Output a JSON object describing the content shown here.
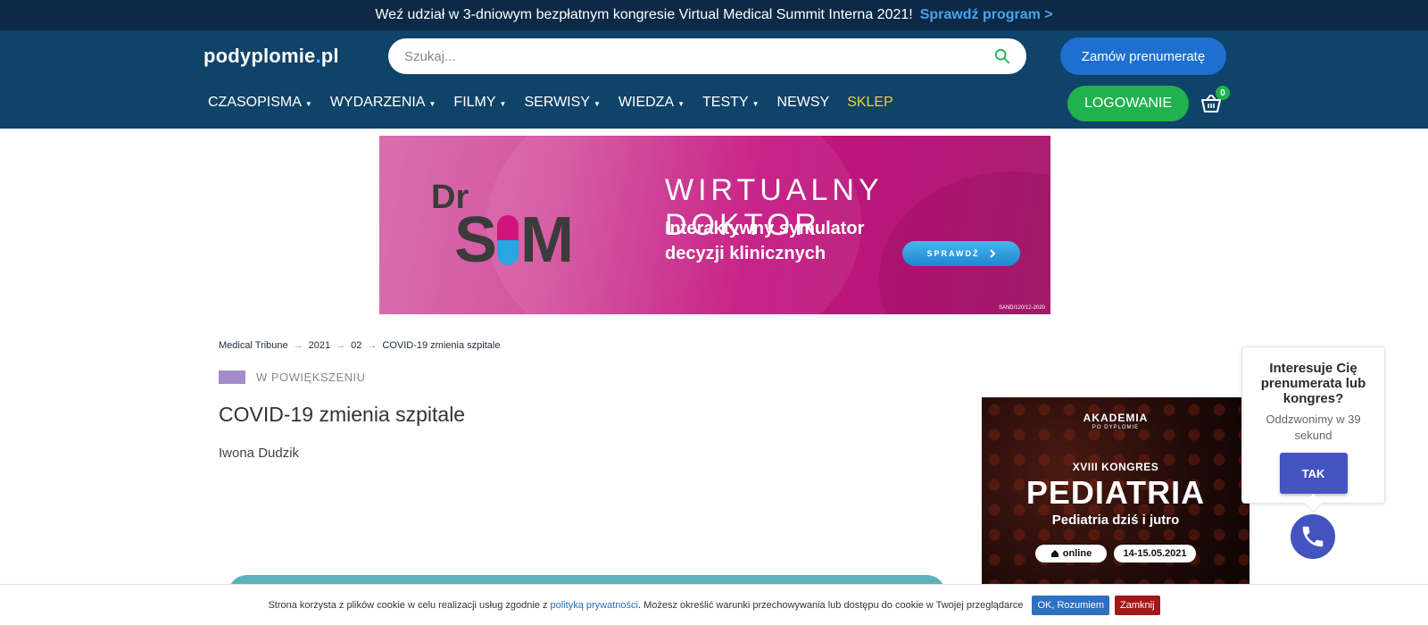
{
  "promo": {
    "text": "Weź udział w 3-dniowym bezpłatnym kongresie Virtual Medical Summit Interna 2021!",
    "link": "Sprawdź program >"
  },
  "header": {
    "logo_main": "podyplomie",
    "logo_dot": ".",
    "logo_tld": "pl",
    "search_placeholder": "Szukaj...",
    "subscribe_label": "Zamów prenumeratę",
    "login_label": "LOGOWANIE",
    "cart_count": "0",
    "nav": [
      {
        "label": "CZASOPISMA",
        "caret": "▼"
      },
      {
        "label": "WYDARZENIA",
        "caret": "▼"
      },
      {
        "label": "FILMY",
        "caret": "▼"
      },
      {
        "label": "SERWISY",
        "caret": "▼"
      },
      {
        "label": "WIEDZA",
        "caret": "▼"
      },
      {
        "label": "TESTY",
        "caret": "▼"
      },
      {
        "label": "NEWSY",
        "caret": ""
      },
      {
        "label": "SKLEP",
        "caret": ""
      }
    ]
  },
  "banner": {
    "dr": "Dr",
    "sim_s": "S",
    "sim_m": "M",
    "headline": "WIRTUALNY DOKTOR",
    "sub_line1": "Interaktywny symulator",
    "sub_line2": "decyzji klinicznych",
    "button": "SPRAWDŹ",
    "code": "SAND/120/12-2020"
  },
  "breadcrumb": [
    "Medical Tribune",
    "2021",
    "02",
    "COVID-19 zmienia szpitale"
  ],
  "breadcrumb_sep": "→",
  "article": {
    "category": "W POWIĘKSZENIU",
    "title": "COVID-19 zmienia szpitale",
    "author": "Iwona Dudzik"
  },
  "side_ad": {
    "akademia": "AKADEMIA",
    "akademia_sub": "PO DYPLOMIE",
    "kongres": "XVIII KONGRES",
    "title": "PEDIATRIA",
    "tagline": "Pediatria dziś i jutro",
    "online": "online",
    "dates": "14-15.05.2021"
  },
  "callback": {
    "question": "Interesuje Cię prenumerata lub kongres?",
    "countdown": "Oddzwonimy w 39 sekund",
    "button": "TAK"
  },
  "cookie": {
    "text_before": "Strona korzysta z plików cookie w celu realizacji usług zgodnie z",
    "link": "polityką prywatności",
    "text_after": ". Możesz określić warunki przechowywania lub dostępu do cookie w Twojej przeglądarce",
    "ok_label": "OK, Rozumiem",
    "close_label": "Zamknij"
  }
}
